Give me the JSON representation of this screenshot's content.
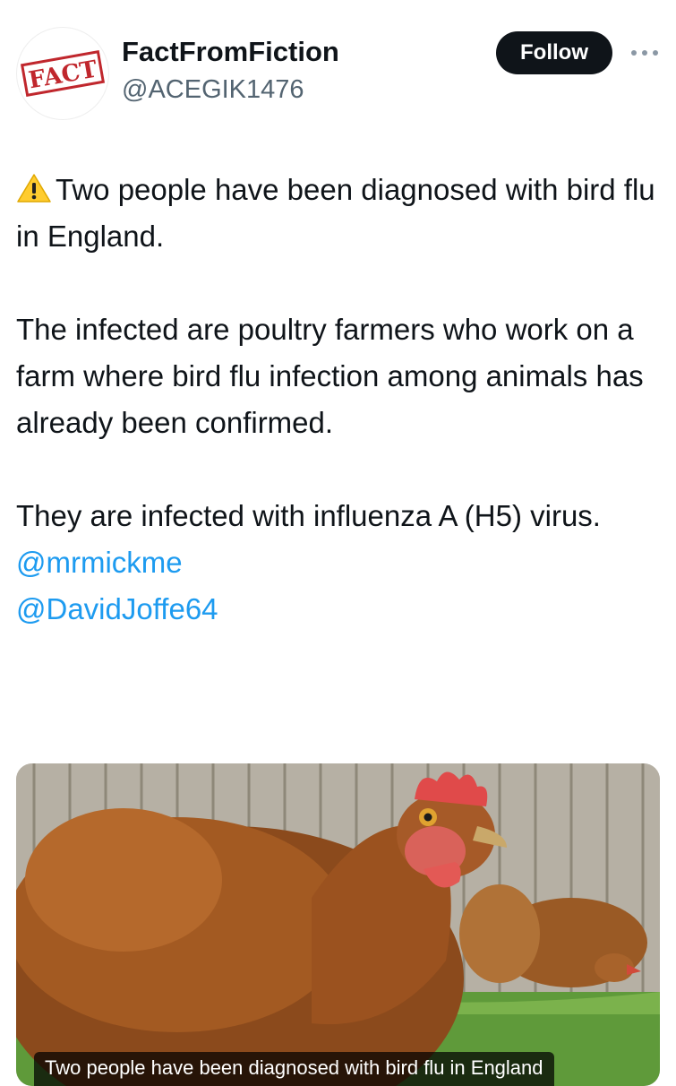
{
  "account": {
    "display_name": "FactFromFiction",
    "handle": "@ACEGIK1476",
    "avatar_stamp_text": "FACT"
  },
  "actions": {
    "follow_label": "Follow",
    "more_icon": "more-horizontal-icon"
  },
  "tweet": {
    "warning_icon": "warning-icon",
    "paragraph_1": "Two people have been diagnosed with bird flu in England.",
    "paragraph_2": "The infected are poultry farmers who work on a farm where bird flu infection among animals has already been confirmed.",
    "paragraph_3": "They are infected with influenza A (H5) virus.",
    "mentions": [
      "@mrmickme",
      "@DavidJoffe64"
    ]
  },
  "media": {
    "caption": "Two people have been diagnosed with bird flu in England"
  },
  "colors": {
    "text": "#0f1419",
    "secondary_text": "#536471",
    "link": "#1d9bf0",
    "follow_bg": "#0f1419",
    "stamp_red": "#c0272d"
  }
}
